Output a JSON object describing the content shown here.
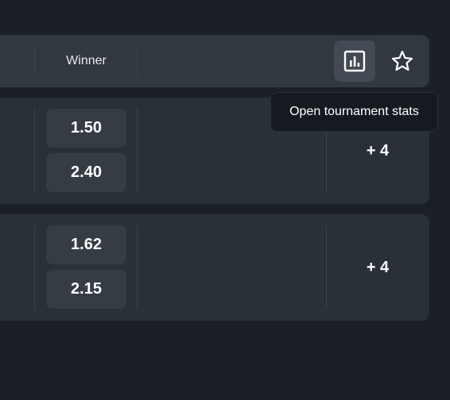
{
  "header": {
    "column_title": "Winner",
    "stats_icon": "bar-chart-icon",
    "favorite_icon": "star-outline-icon"
  },
  "tooltip": {
    "text": "Open tournament stats"
  },
  "matches": [
    {
      "odds": [
        "1.50",
        "2.40"
      ],
      "more_markets": "+ 4"
    },
    {
      "odds": [
        "1.62",
        "2.15"
      ],
      "more_markets": "+ 4"
    }
  ]
}
